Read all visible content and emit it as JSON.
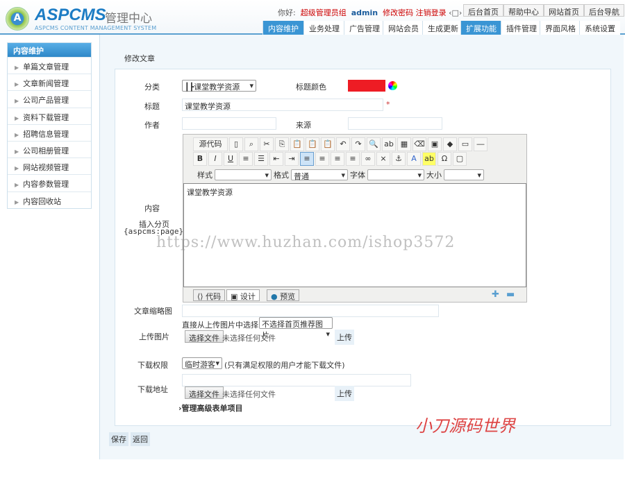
{
  "header": {
    "logo": "ASPCMS",
    "logo_cn": "管理中心",
    "logo_sub": "ASPCMS CONTENT MANAGEMENT SYSTEM",
    "greeting": "你好:",
    "role": "超级管理员组",
    "user": "admin",
    "change_pwd": "修改密码",
    "logout": "注销登录",
    "top_buttons": [
      "后台首页",
      "帮助中心",
      "网站首页",
      "后台导航"
    ],
    "tabs": [
      "内容维护",
      "业务处理",
      "广告管理",
      "网站会员",
      "生成更新",
      "扩展功能",
      "插件管理",
      "界面风格",
      "系统设置"
    ],
    "active_tabs": [
      "内容维护",
      "扩展功能"
    ]
  },
  "sidebar": {
    "title": "内容维护",
    "items": [
      "单篇文章管理",
      "文章新闻管理",
      "公司产品管理",
      "资料下载管理",
      "招聘信息管理",
      "公司相册管理",
      "网站视频管理",
      "内容参数管理",
      "内容回收站"
    ]
  },
  "main": {
    "title": "修改文章",
    "form": {
      "category_label": "分类",
      "category_value": "┃┣课堂教学资源",
      "title_color_label": "标题颜色",
      "title_color_value": "#ee1c24",
      "title_label": "标题",
      "title_value": "课堂教学资源",
      "required": "*",
      "author_label": "作者",
      "author_value": "",
      "source_label": "来源",
      "source_value": "",
      "content_label": "内容",
      "page_break_label": "插入分页",
      "page_break_code": "{aspcms:page}",
      "editor": {
        "source_btn": "源代码",
        "style_label": "样式",
        "format_label": "格式",
        "format_value": "普通",
        "font_label": "字体",
        "size_label": "大小",
        "content": "课堂教学资源",
        "mode_tabs": [
          "代码",
          "设计",
          "预览"
        ]
      },
      "thumb_label": "文章缩略图",
      "thumb_value": "",
      "pick_label": "直接从上传图片中选择:",
      "pick_value": "不选择首页推荐图片",
      "upload_label": "上传图片",
      "choose_file": "选择文件",
      "no_file": "未选择任何文件",
      "upload_btn": "上传",
      "perm_label": "下载权限",
      "perm_value": "临时游客",
      "perm_note": "(只有满足权限的用户才能下载文件)",
      "download_label": "下载地址",
      "download_value": "",
      "advanced": "管理高级表单项目"
    },
    "save": "保存",
    "back": "返回"
  },
  "watermark": {
    "url": "https://www.huzhan.com/ishop3572",
    "brand": "小刀源码世界"
  }
}
